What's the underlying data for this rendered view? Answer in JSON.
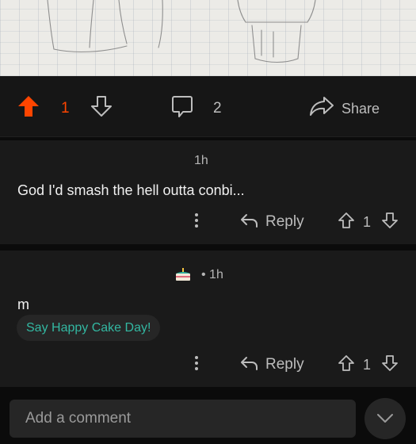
{
  "post_actions": {
    "upvote_count": "1",
    "comment_count": "2",
    "share_label": "Share",
    "colors": {
      "upvoted": "#ff4500",
      "icon": "#bdbdbd"
    }
  },
  "comments": [
    {
      "timestamp": "1h",
      "body": "God I'd smash the hell outta conbi...",
      "reply_label": "Reply",
      "score": "1"
    },
    {
      "timestamp": "• 1h",
      "flair_icon": "cake-icon",
      "body": "m",
      "cake_day_label": "Say Happy Cake Day!",
      "reply_label": "Reply",
      "score": "1"
    }
  ],
  "composer": {
    "placeholder": "Add a comment",
    "expand_icon": "chevron-down-icon"
  }
}
